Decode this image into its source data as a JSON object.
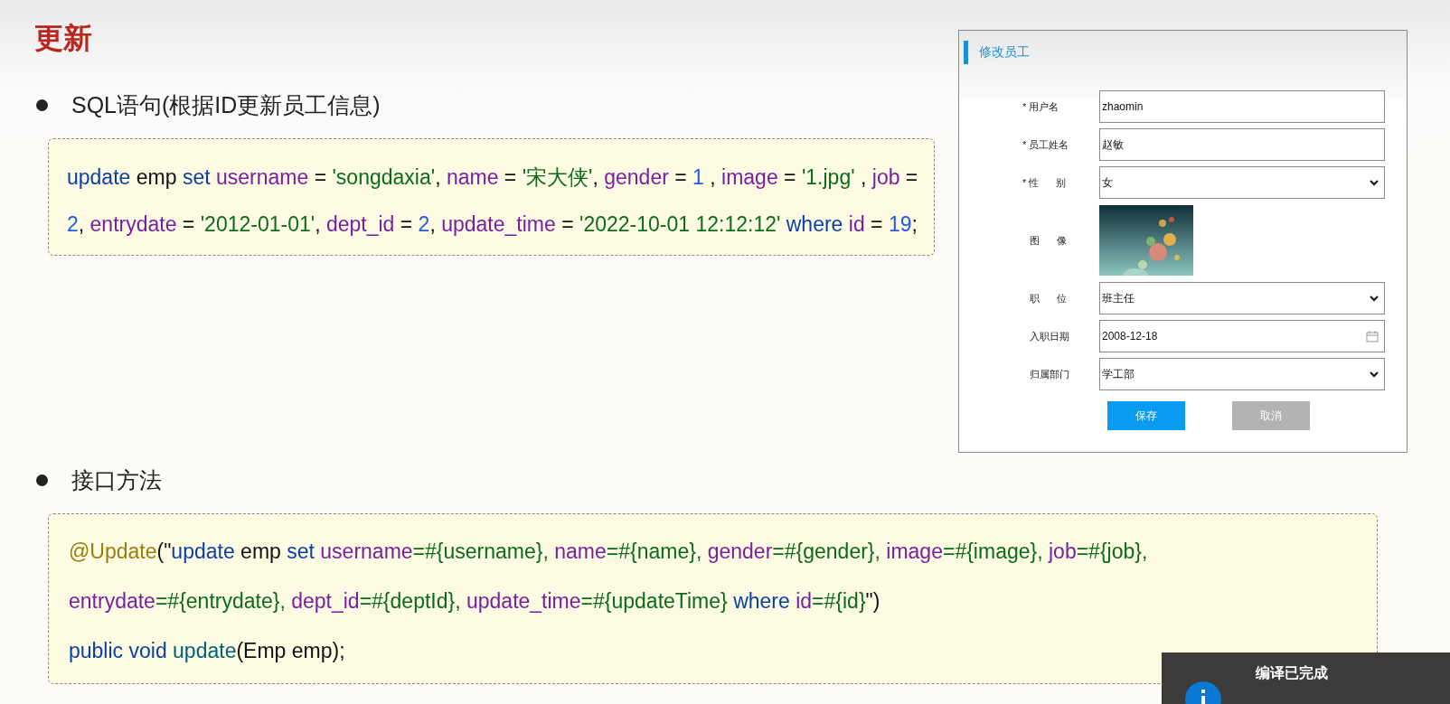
{
  "title": "更新",
  "sections": [
    {
      "bullet": "SQL语句(根据ID更新员工信息)",
      "code": [
        [
          {
            "kind": "keyword",
            "text": "update"
          },
          {
            "kind": "plain",
            "text": " emp "
          },
          {
            "kind": "keyword",
            "text": "set"
          },
          {
            "kind": "field",
            "text": " username"
          },
          {
            "kind": "plain",
            "text": " = "
          },
          {
            "kind": "string",
            "text": "'songdaxia'"
          },
          {
            "kind": "plain",
            "text": ", "
          },
          {
            "kind": "field",
            "text": "name"
          },
          {
            "kind": "plain",
            "text": " = "
          },
          {
            "kind": "string",
            "text": "'宋大侠'"
          },
          {
            "kind": "plain",
            "text": ", "
          },
          {
            "kind": "field",
            "text": "gender"
          },
          {
            "kind": "plain",
            "text": " = "
          },
          {
            "kind": "number",
            "text": "1"
          },
          {
            "kind": "plain",
            "text": " , "
          },
          {
            "kind": "field",
            "text": "image"
          },
          {
            "kind": "plain",
            "text": " = "
          },
          {
            "kind": "string",
            "text": "'1.jpg'"
          },
          {
            "kind": "plain",
            "text": " , "
          },
          {
            "kind": "field",
            "text": "job"
          },
          {
            "kind": "plain",
            "text": " ="
          }
        ],
        [
          {
            "kind": "number",
            "text": "2"
          },
          {
            "kind": "plain",
            "text": ", "
          },
          {
            "kind": "field",
            "text": "entrydate"
          },
          {
            "kind": "plain",
            "text": " = "
          },
          {
            "kind": "string",
            "text": "'2012-01-01'"
          },
          {
            "kind": "plain",
            "text": ", "
          },
          {
            "kind": "field",
            "text": "dept_id"
          },
          {
            "kind": "plain",
            "text": " = "
          },
          {
            "kind": "number",
            "text": "2"
          },
          {
            "kind": "plain",
            "text": ", "
          },
          {
            "kind": "field",
            "text": "update_time"
          },
          {
            "kind": "plain",
            "text": " = "
          },
          {
            "kind": "string",
            "text": "'2022-10-01 12:12:12'"
          },
          {
            "kind": "keyword",
            "text": " where"
          },
          {
            "kind": "field",
            "text": " id"
          },
          {
            "kind": "plain",
            "text": " = "
          },
          {
            "kind": "number",
            "text": "19"
          },
          {
            "kind": "plain",
            "text": ";"
          }
        ]
      ]
    },
    {
      "bullet": "接口方法",
      "code": [
        [
          {
            "kind": "annotation",
            "text": "@Update"
          },
          {
            "kind": "plain",
            "text": "(\""
          },
          {
            "kind": "keyword",
            "text": "update"
          },
          {
            "kind": "plain",
            "text": " emp "
          },
          {
            "kind": "keyword",
            "text": "set"
          },
          {
            "kind": "field",
            "text": " username"
          },
          {
            "kind": "string",
            "text": "=#{username}, "
          },
          {
            "kind": "field",
            "text": "name"
          },
          {
            "kind": "string",
            "text": "=#{name}, "
          },
          {
            "kind": "field",
            "text": "gender"
          },
          {
            "kind": "string",
            "text": "=#{gender}, "
          },
          {
            "kind": "field",
            "text": "image"
          },
          {
            "kind": "string",
            "text": "=#{image}, "
          },
          {
            "kind": "field",
            "text": "job"
          },
          {
            "kind": "string",
            "text": "=#{job},"
          }
        ],
        [
          {
            "kind": "field",
            "text": "entrydate"
          },
          {
            "kind": "string",
            "text": "=#{entrydate}, "
          },
          {
            "kind": "field",
            "text": "dept_id"
          },
          {
            "kind": "string",
            "text": "=#{deptId}, "
          },
          {
            "kind": "field",
            "text": "update_time"
          },
          {
            "kind": "string",
            "text": "=#{updateTime} "
          },
          {
            "kind": "keyword",
            "text": "where"
          },
          {
            "kind": "field",
            "text": " id"
          },
          {
            "kind": "string",
            "text": "=#{id}"
          },
          {
            "kind": "plain",
            "text": "\")"
          }
        ],
        [
          {
            "kind": "keyword",
            "text": "public void "
          },
          {
            "kind": "method",
            "text": "update"
          },
          {
            "kind": "plain",
            "text": "(Emp emp);"
          }
        ]
      ]
    }
  ],
  "form": {
    "title": "修改员工",
    "fields": [
      {
        "kind": "text",
        "required_mark": "*",
        "label": "用户名",
        "value": "zhaomin"
      },
      {
        "kind": "text",
        "required_mark": "*",
        "label": "员工姓名",
        "value": "赵敏"
      },
      {
        "kind": "select",
        "required_mark": "*",
        "label": "性 别",
        "value": "女"
      },
      {
        "label": "图 像"
      },
      {
        "kind": "select",
        "label": "职 位",
        "value": "班主任"
      },
      {
        "kind": "date",
        "label": "入职日期",
        "value": "2008-12-18"
      },
      {
        "kind": "select",
        "label": "归属部门",
        "value": "学工部"
      }
    ],
    "buttons": [
      {
        "kind": "primary",
        "label": "保存"
      },
      {
        "kind": "secondary",
        "label": "取消"
      }
    ]
  },
  "toast": {
    "title": "编译已完成"
  }
}
